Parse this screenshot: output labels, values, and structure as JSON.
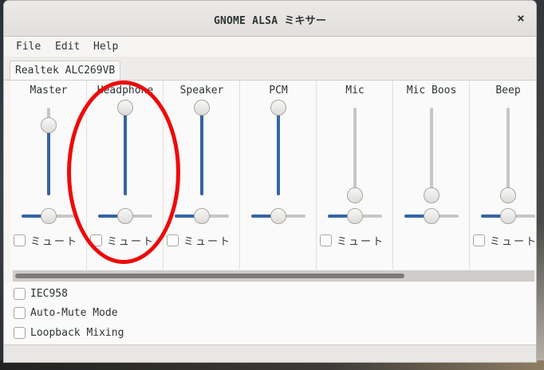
{
  "window": {
    "title": "GNOME ALSA ミキサー",
    "close_symbol": "×"
  },
  "menu": {
    "items": [
      "File",
      "Edit",
      "Help"
    ]
  },
  "tabs": [
    {
      "label": "Realtek ALC269VB"
    }
  ],
  "channels": [
    {
      "label": "Master",
      "volume": 0.8,
      "balance": 0.5,
      "mute_label": "ミュート",
      "has_mute": true
    },
    {
      "label": "Headphone",
      "volume": 1.0,
      "balance": 0.5,
      "mute_label": "ミュート",
      "has_mute": true
    },
    {
      "label": "Speaker",
      "volume": 1.0,
      "balance": 0.5,
      "mute_label": "ミュート",
      "has_mute": true
    },
    {
      "label": "PCM",
      "volume": 1.0,
      "balance": 0.5,
      "mute_label": "",
      "has_mute": false
    },
    {
      "label": "Mic",
      "volume": 0.0,
      "balance": 0.5,
      "mute_label": "ミュート",
      "has_mute": true
    },
    {
      "label": "Mic Boos",
      "volume": 0.0,
      "balance": 0.5,
      "mute_label": "",
      "has_mute": false
    },
    {
      "label": "Beep",
      "volume": 0.0,
      "balance": 0.5,
      "mute_label": "ミュート",
      "has_mute": true
    }
  ],
  "options": [
    {
      "label": "IEC958",
      "checked": false
    },
    {
      "label": "Auto-Mute Mode",
      "checked": false
    },
    {
      "label": "Loopback Mixing",
      "checked": false
    }
  ],
  "colors": {
    "accent": "#3465a4",
    "annotation": "#ee0a0a"
  }
}
